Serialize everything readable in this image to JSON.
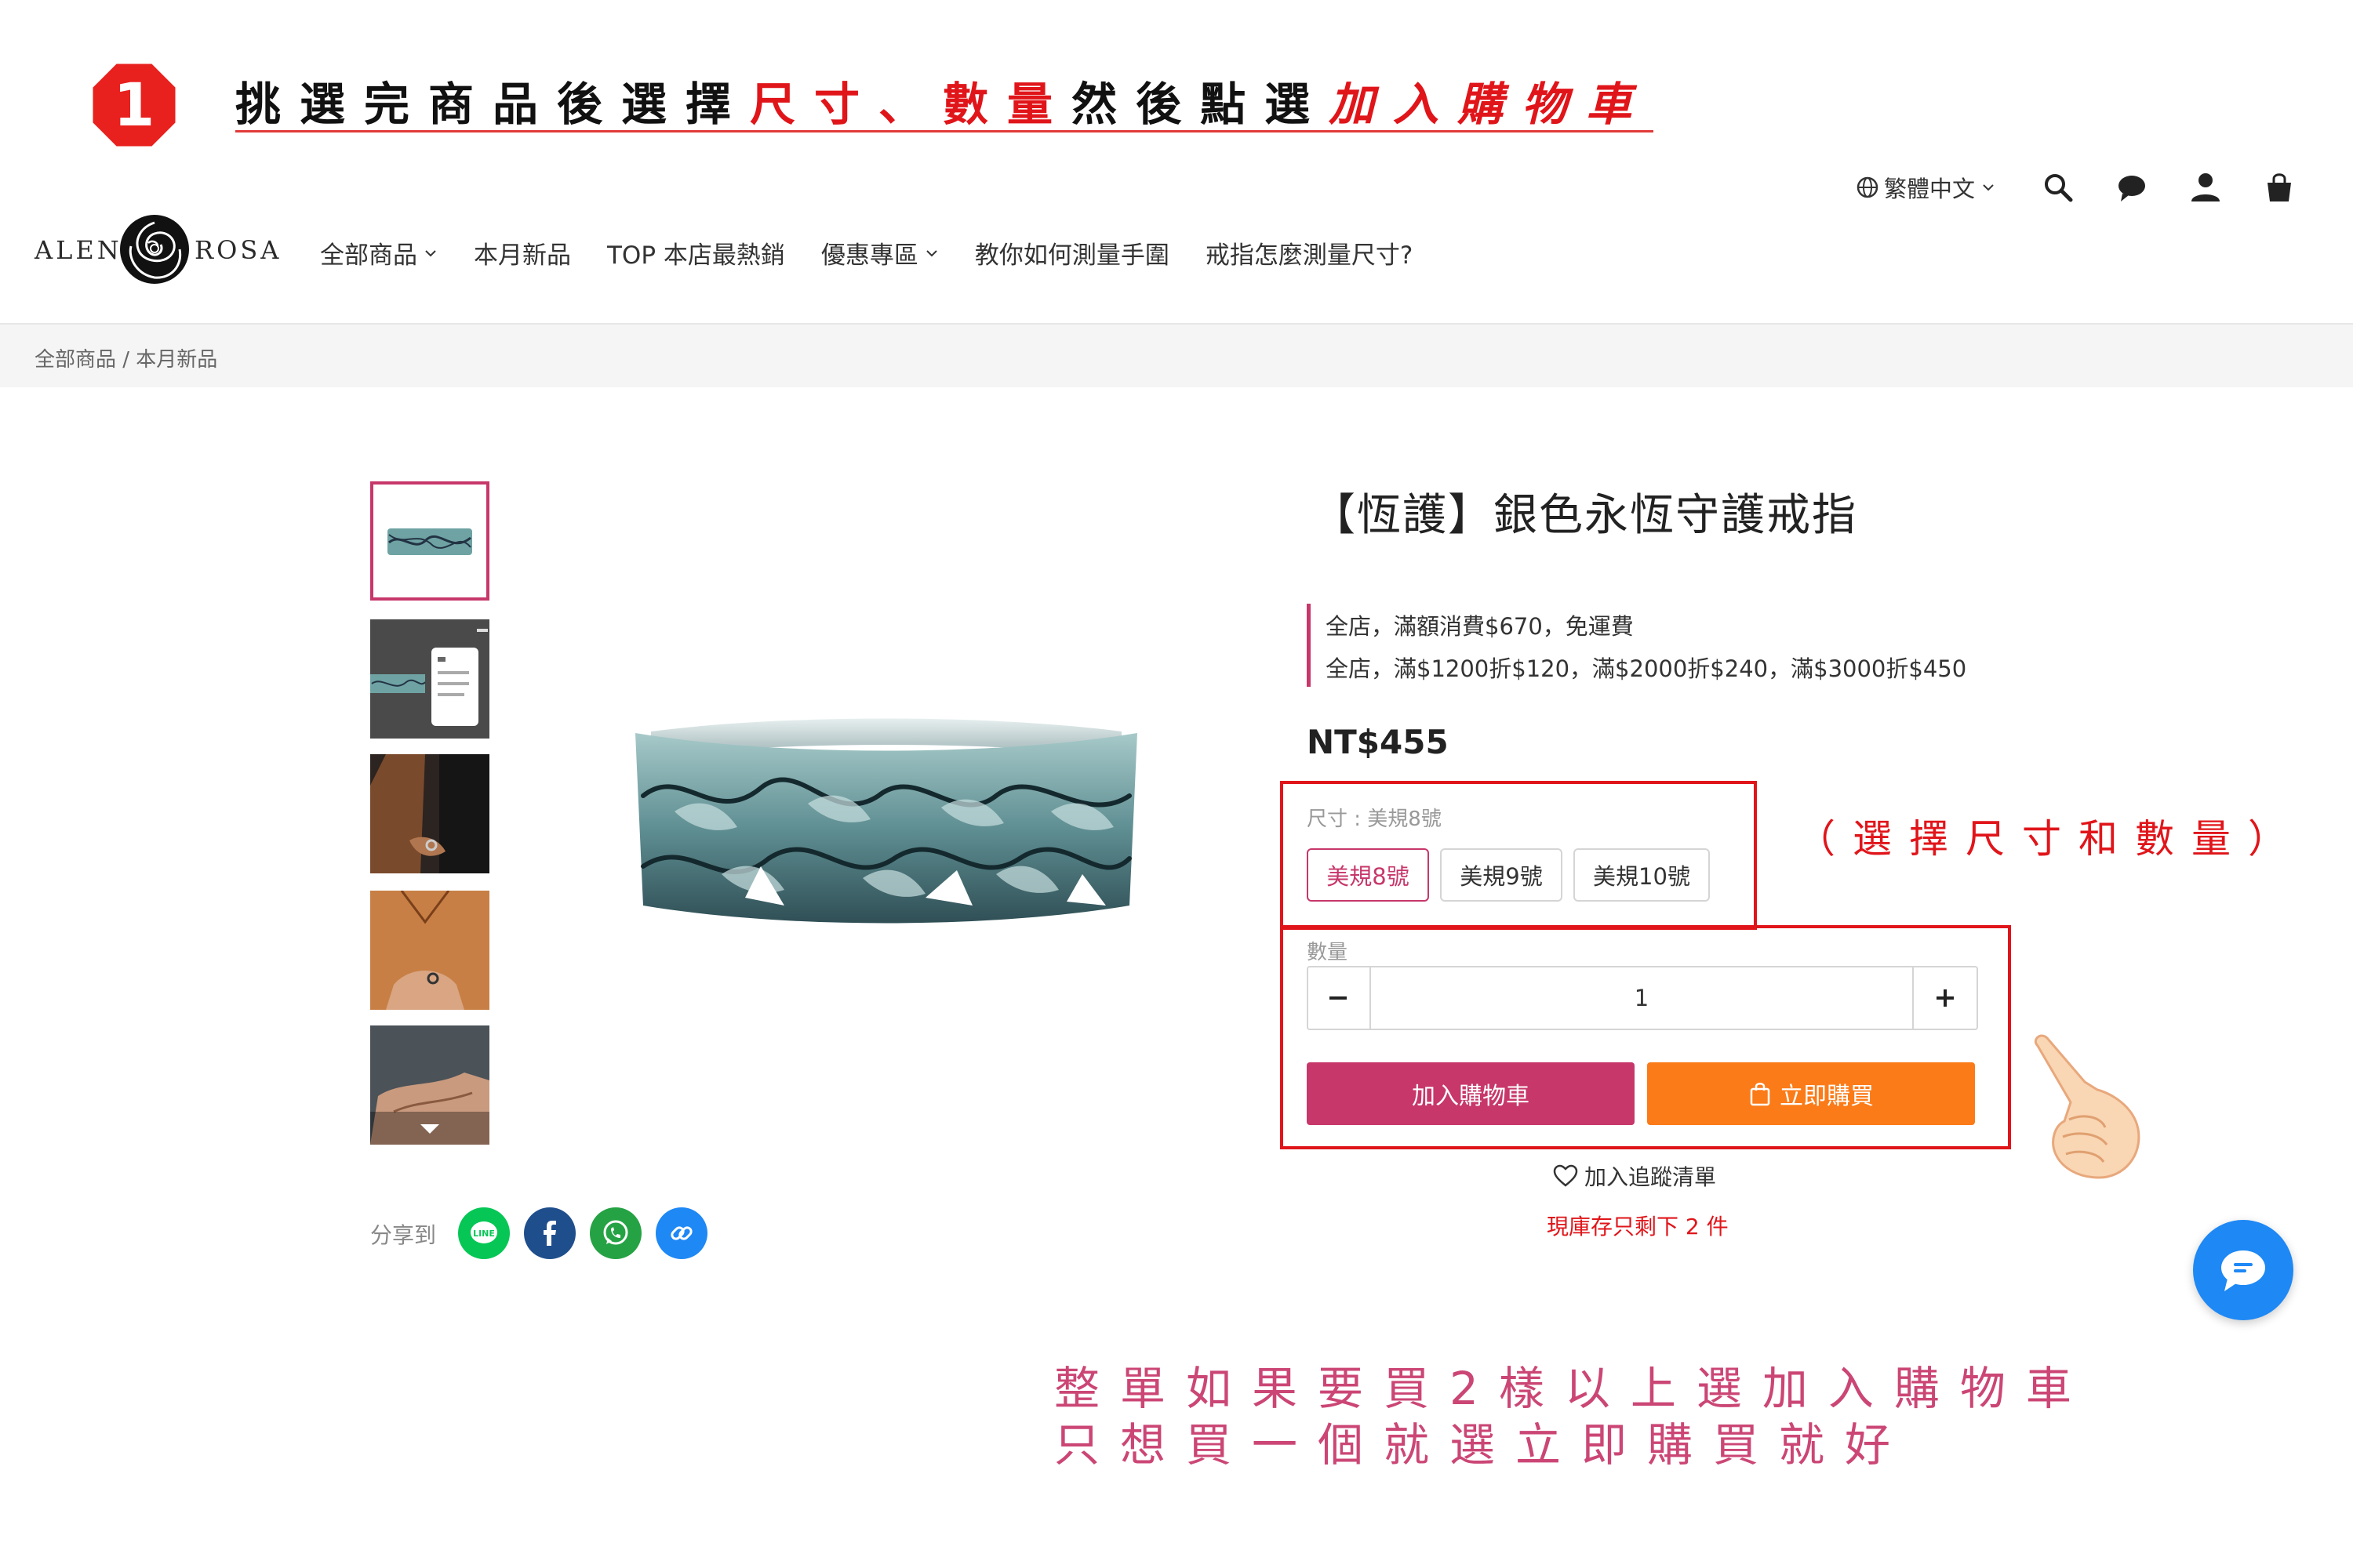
{
  "instruction": {
    "step_number": "1",
    "text_part1": "挑選完商品後選擇",
    "text_size": "尺寸",
    "text_sep": "、",
    "text_qty": "數量",
    "text_part2": "然後點選",
    "text_add_cart": "加入購物車"
  },
  "header": {
    "logo_left": "ALEN",
    "logo_right": "ROSA",
    "language": "繁體中文",
    "nav": [
      {
        "label": "全部商品",
        "dropdown": true
      },
      {
        "label": "本月新品",
        "dropdown": false
      },
      {
        "label": "TOP 本店最熱銷",
        "dropdown": false
      },
      {
        "label": "優惠專區",
        "dropdown": true
      },
      {
        "label": "教你如何測量手圍",
        "dropdown": false
      },
      {
        "label": "戒指怎麼測量尺寸?",
        "dropdown": false
      }
    ],
    "icons": [
      "globe-icon",
      "search-icon",
      "message-icon",
      "user-icon",
      "cart-icon"
    ]
  },
  "breadcrumb": {
    "text": "全部商品 / 本月新品"
  },
  "product": {
    "title": "【恆護】銀色永恆守護戒指",
    "promos": [
      "全店，滿額消費$670，免運費",
      "全店，滿$1200折$120，滿$2000折$240，滿$3000折$450"
    ],
    "price": "NT$455",
    "size_label": "尺寸 : 美規8號",
    "sizes": [
      "美規8號",
      "美規9號",
      "美規10號"
    ],
    "selected_size": "美規8號",
    "qty_label": "數量",
    "qty_value": "1",
    "add_cart_label": "加入購物車",
    "buy_now_label": "立即購買",
    "wishlist_label": "加入追蹤清單",
    "stock_text": "現庫存只剩下 2 件"
  },
  "share": {
    "label": "分享到",
    "line_text": "LINE"
  },
  "annotations": {
    "size_qty_note": "（選擇尺寸和數量）",
    "bottom_line1": "整單如果要買2樣以上選加入購物車",
    "bottom_line2": "只想買一個就選立即購買就好"
  },
  "colors": {
    "brand_pink": "#c7376a",
    "buy_orange": "#fb7b18",
    "annotation_red": "#e0151a",
    "chat_blue": "#1e88f5"
  }
}
